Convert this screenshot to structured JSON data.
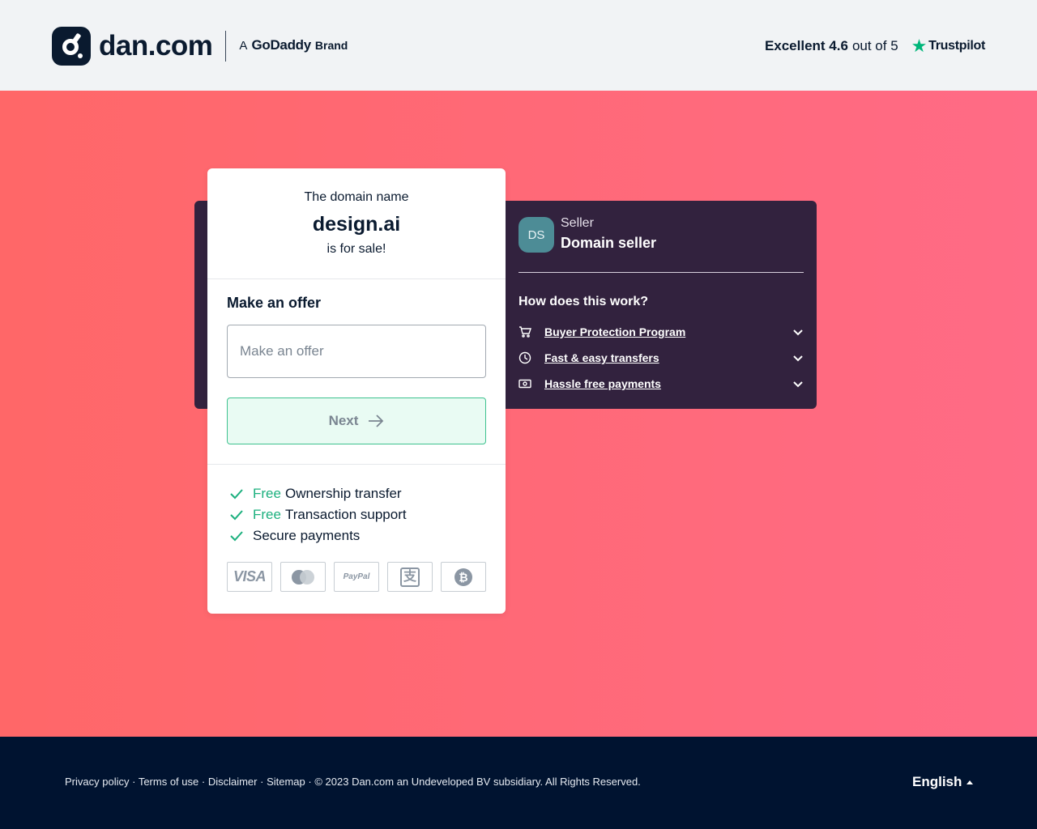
{
  "header": {
    "logo_text": "dan.com",
    "brand": {
      "prefix": "A",
      "name": "GoDaddy",
      "suffix": "Brand"
    },
    "rating": {
      "label": "Excellent 4.6",
      "rest": "out of 5",
      "provider": "Trustpilot"
    }
  },
  "card": {
    "pre": "The domain name",
    "domain": "design.ai",
    "post": "is for sale!",
    "offer_title": "Make an offer",
    "offer_placeholder": "Make an offer",
    "next_label": "Next",
    "features": [
      {
        "free": "Free",
        "text": "Ownership transfer"
      },
      {
        "free": "Free",
        "text": "Transaction support"
      },
      {
        "free": "",
        "text": "Secure payments"
      }
    ],
    "payments": [
      {
        "name": "visa",
        "label": "VISA"
      },
      {
        "name": "mastercard",
        "label": ""
      },
      {
        "name": "paypal",
        "label": "PayPal"
      },
      {
        "name": "alipay",
        "label": "支"
      },
      {
        "name": "bitcoin",
        "label": "₿"
      }
    ]
  },
  "seller": {
    "initials": "DS",
    "label": "Seller",
    "name": "Domain seller"
  },
  "how": {
    "title": "How does this work?",
    "items": [
      {
        "label": "Buyer Protection Program",
        "icon": "cart-icon"
      },
      {
        "label": "Fast & easy transfers",
        "icon": "clock-icon"
      },
      {
        "label": "Hassle free payments",
        "icon": "money-icon"
      }
    ]
  },
  "footer": {
    "links": [
      "Privacy policy",
      "Terms of use",
      "Disclaimer",
      "Sitemap"
    ],
    "copyright": "© 2023 Dan.com an Undeveloped BV subsidiary. All Rights Reserved.",
    "language": "English"
  },
  "colors": {
    "accent_green": "#1cb07e",
    "dark_panel": "#32223e",
    "footer_bg": "#001330",
    "hero_gradient": [
      "#ff6768",
      "#ff6b86"
    ]
  }
}
